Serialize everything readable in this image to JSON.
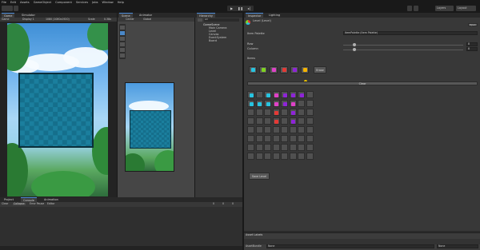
{
  "menu": [
    "File",
    "Edit",
    "Assets",
    "GameObject",
    "Component",
    "Services",
    "Jobs",
    "Window",
    "Help"
  ],
  "toolbar": {
    "account_label": "Layers",
    "layout_label": "Layout"
  },
  "game_tabs": [
    "Game",
    "Simulator"
  ],
  "game_toolbar": {
    "mode": "Game",
    "display": "Display 1",
    "resolution": "1080 (1080x1920)",
    "scale_label": "Scale",
    "scale_value": "0.38x"
  },
  "scene_tabs": [
    "Scene",
    "Animator"
  ],
  "scene_toolbar": {
    "pivot": "Center",
    "space": "Global"
  },
  "hierarchy": {
    "tab": "Hierarchy",
    "search_placeholder": "All",
    "scene": "GameScene",
    "items": [
      "Main Camera",
      "Level",
      "Canvas",
      "EventSystem",
      "Board"
    ]
  },
  "inspector": {
    "tabs": [
      "Inspector",
      "Lighting"
    ],
    "object_name": "Level (Level)",
    "open_label": "Open",
    "item_palette_label": "Item Palette",
    "item_palette_value": "ItemPalette (Item Palette)",
    "row_label": "Row",
    "row_value": "8",
    "column_label": "Column",
    "column_value": "8",
    "items_label": "Items",
    "erase_label": "Erase",
    "clear_label": "Clear",
    "save_label": "Save Level",
    "asset_labels": "Asset Labels",
    "asset_bundle_label": "AssetBundle",
    "asset_bundle_value": "None",
    "asset_variant_value": "None"
  },
  "gem_colors": [
    "#27c4e0",
    "#7ed321",
    "#e040c8",
    "#e53935",
    "#8e24d8",
    "#f4b400"
  ],
  "project_tabs": [
    "Project",
    "Console",
    "Animation"
  ],
  "console": {
    "clear": "Clear",
    "collapse": "Collapse",
    "error_pause": "Error Pause",
    "editor": "Editor",
    "count_a": "0",
    "count_b": "0",
    "count_c": "0"
  }
}
